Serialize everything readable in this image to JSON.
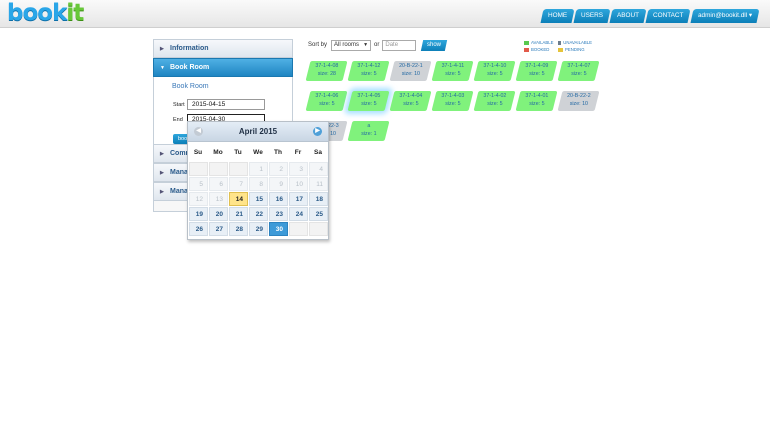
{
  "logo": {
    "part1": "book",
    "part2": "it"
  },
  "topnav": [
    "HOME",
    "USERS",
    "ABOUT",
    "CONTACT",
    "admin@bookit.dll ▾"
  ],
  "accordion": {
    "information": "Information",
    "book_room": "Book Room",
    "form_title": "Book Room",
    "start_label": "Start",
    "start_value": "2015-04-15",
    "end_label": "End",
    "end_value": "2015-04-30",
    "book_btn": "book",
    "comm": "Comm",
    "mana1": "Mana",
    "mana2": "Mana"
  },
  "toolbar": {
    "sort_label": "Sort by",
    "sort_value": "All rooms",
    "or": "or",
    "date_placeholder": "Date",
    "show": "show"
  },
  "legend": {
    "available": "AVAILABLE",
    "unavailable": "UNAVAILABLE",
    "booked": "BOOKED",
    "pending": "PENDING",
    "colors": {
      "available": "#59c94f",
      "unavailable": "#6b7c8c",
      "booked": "#e25a4a",
      "pending": "#e6c43a"
    }
  },
  "rooms": [
    {
      "name": "37-1-4-08",
      "size": "size: 28",
      "status": "available"
    },
    {
      "name": "37-1-4-12",
      "size": "size: 5",
      "status": "available"
    },
    {
      "name": "20-B-22-1",
      "size": "size: 10",
      "status": "unavailable"
    },
    {
      "name": "37-1-4-11",
      "size": "size: 5",
      "status": "available"
    },
    {
      "name": "37-1-4-10",
      "size": "size: 5",
      "status": "available"
    },
    {
      "name": "37-1-4-09",
      "size": "size: 5",
      "status": "available"
    },
    {
      "name": "37-1-4-07",
      "size": "size: 5",
      "status": "available"
    },
    {
      "name": "37-1-4-06",
      "size": "size: 5",
      "status": "available"
    },
    {
      "name": "37-1-4-05",
      "size": "size: 5",
      "status": "available",
      "highlight": true
    },
    {
      "name": "37-1-4-04",
      "size": "size: 5",
      "status": "available"
    },
    {
      "name": "37-1-4-03",
      "size": "size: 5",
      "status": "available"
    },
    {
      "name": "37-1-4-02",
      "size": "size: 5",
      "status": "available"
    },
    {
      "name": "37-1-4-01",
      "size": "size: 5",
      "status": "available"
    },
    {
      "name": "20-B-22-2",
      "size": "size: 10",
      "status": "unavailable"
    },
    {
      "name": "20-B-22-3",
      "size": "size: 10",
      "status": "unavailable"
    },
    {
      "name": "a",
      "size": "size: 1",
      "status": "available"
    }
  ],
  "datepicker": {
    "title": "April 2015",
    "dows": [
      "Su",
      "Mo",
      "Tu",
      "We",
      "Th",
      "Fr",
      "Sa"
    ],
    "weeks": [
      [
        "",
        "",
        "",
        "1",
        "2",
        "3",
        "4"
      ],
      [
        "5",
        "6",
        "7",
        "8",
        "9",
        "10",
        "11"
      ],
      [
        "12",
        "13",
        "14",
        "15",
        "16",
        "17",
        "18"
      ],
      [
        "19",
        "20",
        "21",
        "22",
        "23",
        "24",
        "25"
      ],
      [
        "26",
        "27",
        "28",
        "29",
        "30",
        "",
        ""
      ]
    ],
    "today": "14",
    "selected": "30",
    "enabled_from": 14
  }
}
